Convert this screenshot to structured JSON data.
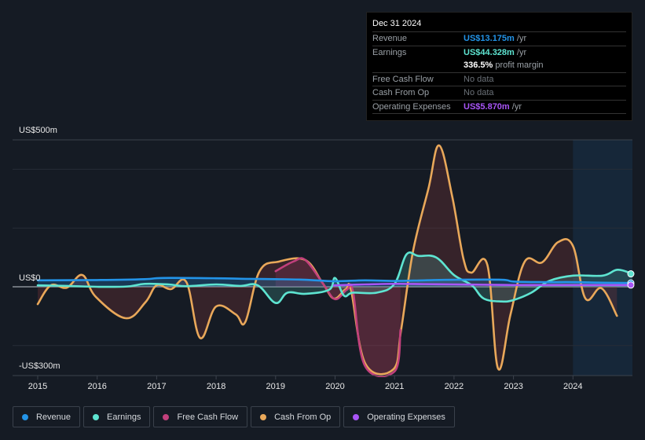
{
  "tooltip": {
    "date": "Dec 31 2024",
    "rows": [
      {
        "label": "Revenue",
        "value": "US$13.175m",
        "unit": "/yr",
        "color": "#2394e8"
      },
      {
        "label": "Earnings",
        "value": "US$44.328m",
        "unit": "/yr",
        "color": "#5ee4d1"
      },
      {
        "label": "",
        "value": "336.5%",
        "unit": "profit margin",
        "color": "#ffffff"
      },
      {
        "label": "Free Cash Flow",
        "value": "No data",
        "unit": "",
        "color": "#6b7178"
      },
      {
        "label": "Cash From Op",
        "value": "No data",
        "unit": "",
        "color": "#6b7178"
      },
      {
        "label": "Operating Expenses",
        "value": "US$5.870m",
        "unit": "/yr",
        "color": "#a855f7"
      }
    ]
  },
  "legend": [
    {
      "label": "Revenue",
      "color": "#2394e8"
    },
    {
      "label": "Earnings",
      "color": "#5ee4d1"
    },
    {
      "label": "Free Cash Flow",
      "color": "#c2407c"
    },
    {
      "label": "Cash From Op",
      "color": "#e9a85a"
    },
    {
      "label": "Operating Expenses",
      "color": "#a855f7"
    }
  ],
  "chart_data": {
    "type": "line",
    "title": "",
    "xlabel": "",
    "ylabel": "",
    "y_tick_labels": [
      {
        "value": 500,
        "label": "US$500m"
      },
      {
        "value": 0,
        "label": "US$0"
      },
      {
        "value": -300,
        "label": "-US$300m"
      }
    ],
    "ylim": [
      -300,
      500
    ],
    "xlim": [
      2014.7,
      2025.0
    ],
    "x_ticks": [
      2015,
      2016,
      2017,
      2018,
      2019,
      2020,
      2021,
      2022,
      2023,
      2024
    ],
    "gridlines": [
      400,
      200,
      0,
      -200
    ],
    "highlight_region": [
      2024.0,
      2025.0
    ],
    "series": [
      {
        "name": "Revenue",
        "color": "#2394e8",
        "points": [
          [
            2015.0,
            22
          ],
          [
            2016.0,
            23
          ],
          [
            2016.8,
            26
          ],
          [
            2017.1,
            30
          ],
          [
            2018.0,
            29
          ],
          [
            2018.5,
            27
          ],
          [
            2019.0,
            26
          ],
          [
            2019.5,
            24
          ],
          [
            2020.0,
            19
          ],
          [
            2020.5,
            22
          ],
          [
            2021.0,
            20
          ],
          [
            2021.5,
            22
          ],
          [
            2022.0,
            24
          ],
          [
            2022.8,
            24
          ],
          [
            2023.0,
            18
          ],
          [
            2023.5,
            16
          ],
          [
            2024.0,
            16
          ],
          [
            2024.5,
            14
          ],
          [
            2025.0,
            13
          ]
        ]
      },
      {
        "name": "Earnings",
        "color": "#5ee4d1",
        "points": [
          [
            2015.0,
            5
          ],
          [
            2015.5,
            3
          ],
          [
            2016.0,
            0
          ],
          [
            2016.5,
            1
          ],
          [
            2016.8,
            10
          ],
          [
            2017.2,
            8
          ],
          [
            2017.5,
            2
          ],
          [
            2018.0,
            8
          ],
          [
            2018.4,
            3
          ],
          [
            2018.7,
            5
          ],
          [
            2019.0,
            -55
          ],
          [
            2019.2,
            -20
          ],
          [
            2019.5,
            -24
          ],
          [
            2019.9,
            -10
          ],
          [
            2020.0,
            30
          ],
          [
            2020.15,
            -30
          ],
          [
            2020.3,
            -20
          ],
          [
            2020.7,
            -20
          ],
          [
            2021.0,
            10
          ],
          [
            2021.2,
            110
          ],
          [
            2021.4,
            105
          ],
          [
            2021.7,
            100
          ],
          [
            2022.0,
            40
          ],
          [
            2022.3,
            5
          ],
          [
            2022.5,
            -40
          ],
          [
            2022.8,
            -50
          ],
          [
            2023.0,
            -45
          ],
          [
            2023.3,
            -20
          ],
          [
            2023.6,
            20
          ],
          [
            2024.0,
            38
          ],
          [
            2024.5,
            38
          ],
          [
            2024.75,
            58
          ],
          [
            2025.0,
            44
          ]
        ]
      },
      {
        "name": "Free Cash Flow",
        "color": "#c2407c",
        "points": [
          [
            2019.0,
            53
          ],
          [
            2019.3,
            86
          ],
          [
            2019.5,
            91
          ],
          [
            2019.8,
            10
          ],
          [
            2020.0,
            -42
          ],
          [
            2020.2,
            -10
          ],
          [
            2020.3,
            -15
          ],
          [
            2020.5,
            -268
          ],
          [
            2021.0,
            -288
          ],
          [
            2021.1,
            -147
          ]
        ]
      },
      {
        "name": "Cash From Op",
        "color": "#e9a85a",
        "points": [
          [
            2015.0,
            -59
          ],
          [
            2015.22,
            5
          ],
          [
            2015.49,
            -3
          ],
          [
            2015.75,
            40
          ],
          [
            2015.98,
            -35
          ],
          [
            2016.48,
            -107
          ],
          [
            2016.81,
            -53
          ],
          [
            2017.0,
            5
          ],
          [
            2017.24,
            -8
          ],
          [
            2017.5,
            16
          ],
          [
            2017.73,
            -174
          ],
          [
            2018.0,
            -67
          ],
          [
            2018.33,
            -94
          ],
          [
            2018.49,
            -120
          ],
          [
            2018.73,
            53
          ],
          [
            2019.06,
            86
          ],
          [
            2019.5,
            91
          ],
          [
            2019.79,
            13
          ],
          [
            2019.98,
            -40
          ],
          [
            2020.18,
            -8
          ],
          [
            2020.27,
            -13
          ],
          [
            2020.51,
            -262
          ],
          [
            2020.98,
            -281
          ],
          [
            2021.11,
            -147
          ],
          [
            2021.31,
            120
          ],
          [
            2021.57,
            334
          ],
          [
            2021.75,
            481
          ],
          [
            2021.97,
            307
          ],
          [
            2022.16,
            94
          ],
          [
            2022.29,
            48
          ],
          [
            2022.56,
            75
          ],
          [
            2022.74,
            -278
          ],
          [
            2022.95,
            -94
          ],
          [
            2023.19,
            86
          ],
          [
            2023.48,
            83
          ],
          [
            2023.75,
            152
          ],
          [
            2024.0,
            139
          ],
          [
            2024.21,
            -40
          ],
          [
            2024.48,
            -5
          ],
          [
            2024.74,
            -99
          ]
        ]
      },
      {
        "name": "Operating Expenses",
        "color": "#a855f7",
        "points": [
          [
            2019.98,
            5
          ],
          [
            2020.5,
            8
          ],
          [
            2021.0,
            10
          ],
          [
            2021.5,
            9
          ],
          [
            2022.0,
            8
          ],
          [
            2022.5,
            7
          ],
          [
            2023.0,
            6
          ],
          [
            2023.5,
            6
          ],
          [
            2024.0,
            6
          ],
          [
            2024.5,
            6
          ],
          [
            2025.0,
            5.87
          ]
        ]
      }
    ]
  }
}
